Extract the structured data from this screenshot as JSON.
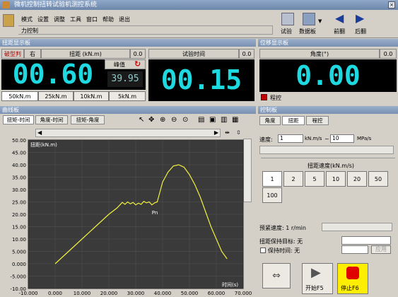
{
  "app": {
    "title": "微机控制扭转试验机测控系统"
  },
  "menu": [
    "模式",
    "设置",
    "调整",
    "工具",
    "窗口",
    "帮助",
    "退出"
  ],
  "toolbar": {
    "mode": "力控制",
    "test": "试验",
    "data": "数据板",
    "prev": "前翻",
    "next": "后翻"
  },
  "torque_panel": {
    "title": "扭距显示板",
    "break_label": "破型判断",
    "break_value": "右",
    "name": "扭距 (kN.m)",
    "zero": "0.0",
    "value": "00.60",
    "peak_label": "峰值",
    "peak_value": "39.95",
    "ranges": [
      "50kN.m",
      "25kN.m",
      "10kN.m",
      "5kN.m"
    ]
  },
  "time_panel": {
    "name": "试验时间",
    "zero": "0.0",
    "value": "00.15"
  },
  "angle_panel": {
    "title": "位移显示板",
    "name": "角度(°)",
    "zero": "0.0",
    "value": "0.00",
    "mode": "程控"
  },
  "curve_panel": {
    "title": "曲线板",
    "tabs": [
      "扭矩-时间",
      "角度-时间",
      "扭矩-角度"
    ]
  },
  "control_panel": {
    "title": "控制板",
    "tabs": [
      "角度",
      "扭距",
      "程控"
    ],
    "speed_label": "速度:",
    "speed_value": "1",
    "speed_unit": "kN.m/s",
    "speed_to": "~",
    "speed_value2": "10",
    "speed_unit2": "MPa/s",
    "rate_title": "扭距速度(kN.m/s)",
    "rates": [
      "1",
      "2",
      "5",
      "10",
      "20",
      "50",
      "100"
    ],
    "preload_label": "预紧速度: 1 r/min",
    "hold_target": "扭距保持目标: 无",
    "hold_time": "保持时间: 无",
    "apply": "应用",
    "start": "开始F5",
    "stop": "停止F6"
  },
  "chart_data": {
    "type": "line",
    "ylabel": "扭距(kN.m)",
    "xlabel": "时间(s)",
    "marker_label": "Pn",
    "xlim": [
      -10,
      70
    ],
    "ylim": [
      -10,
      50
    ],
    "xticks": [
      "-10.000",
      "0.000",
      "10.000",
      "20.000",
      "30.000",
      "40.000",
      "50.000",
      "60.000",
      "70.000"
    ],
    "yticks": [
      "50.00",
      "45.00",
      "40.00",
      "35.00",
      "30.00",
      "25.00",
      "20.00",
      "15.00",
      "10.00",
      "5.000",
      "0.000",
      "-5.000",
      "-10.00"
    ],
    "series": [
      {
        "x": [
          0,
          5,
          10,
          15,
          20,
          23,
          25,
          26,
          27,
          28,
          29,
          30,
          31,
          32,
          33,
          34,
          35,
          36,
          37,
          38,
          39,
          40,
          42,
          44,
          46,
          48,
          50,
          52,
          54,
          56,
          58,
          60,
          62,
          64
        ],
        "y": [
          0,
          5,
          10,
          15,
          20,
          22.5,
          24.8,
          24,
          25,
          24.2,
          24.8,
          23.8,
          24.5,
          24,
          25.2,
          24.6,
          25,
          23.8,
          24.6,
          25,
          29,
          33,
          37,
          39.5,
          40,
          39,
          36,
          32,
          27,
          21,
          15,
          10,
          5,
          2
        ]
      }
    ]
  }
}
